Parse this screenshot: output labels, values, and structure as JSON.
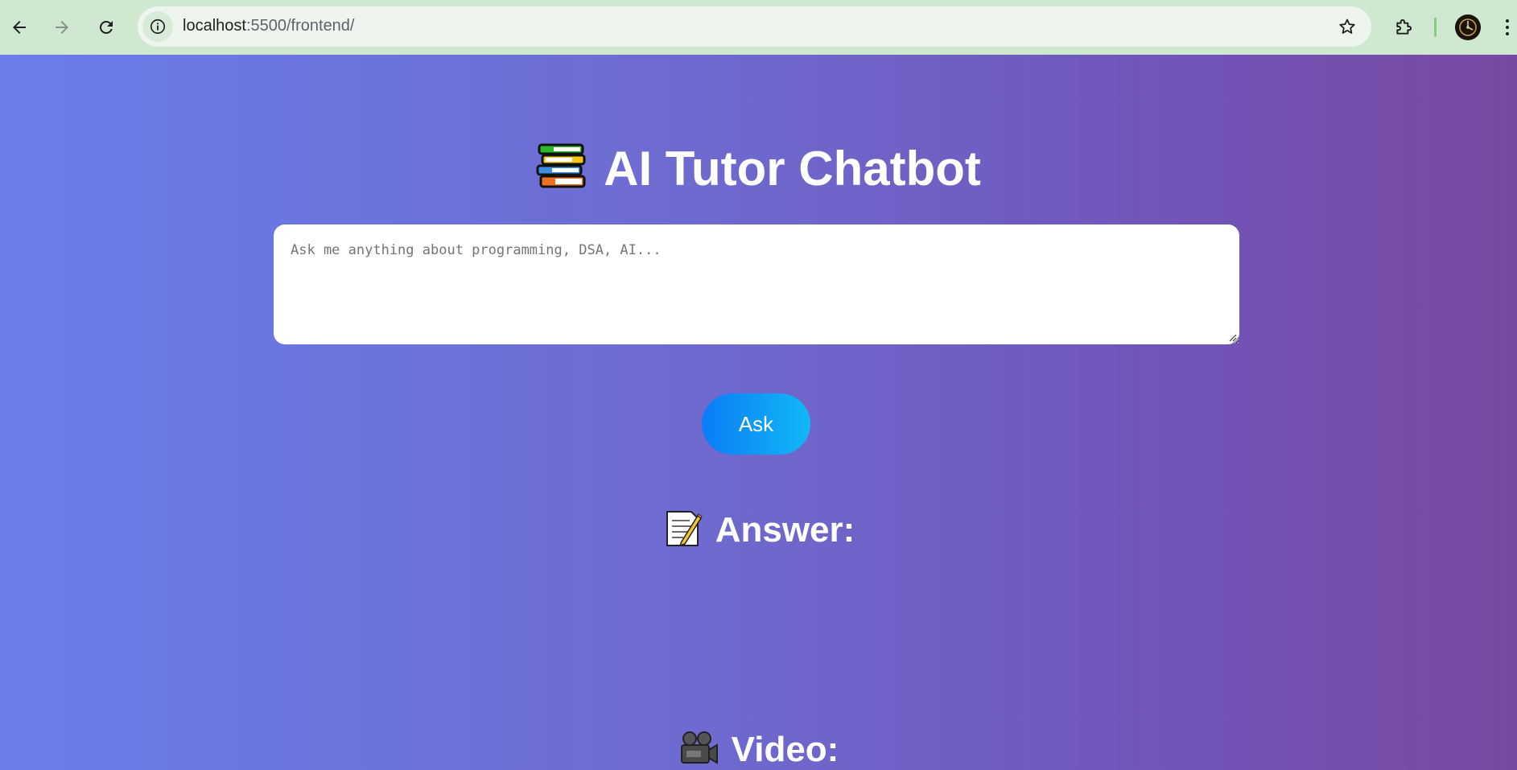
{
  "browser": {
    "url_host": "localhost",
    "url_path": ":5500/frontend/",
    "back_icon": "arrow-left-icon",
    "forward_icon": "arrow-right-icon",
    "reload_icon": "reload-icon",
    "site_info_icon": "info-icon",
    "bookmark_icon": "star-icon",
    "extensions_icon": "puzzle-icon",
    "menu_icon": "kebab-menu-icon"
  },
  "app": {
    "title_icon": "books-icon",
    "title": "AI Tutor Chatbot",
    "question_placeholder": "Ask me anything about programming, DSA, AI...",
    "question_value": "",
    "ask_label": "Ask",
    "answer_icon": "memo-icon",
    "answer_heading": "Answer:",
    "answer_text": "",
    "video_icon": "movie-camera-icon",
    "video_heading": "Video:"
  },
  "colors": {
    "browser_bar": "#cfe8cf",
    "gradient_start": "#6a7deb",
    "gradient_end": "#774aa2",
    "ask_button_start": "#0a7cf7",
    "ask_button_end": "#12b8f6",
    "text_white": "#ffffff"
  }
}
